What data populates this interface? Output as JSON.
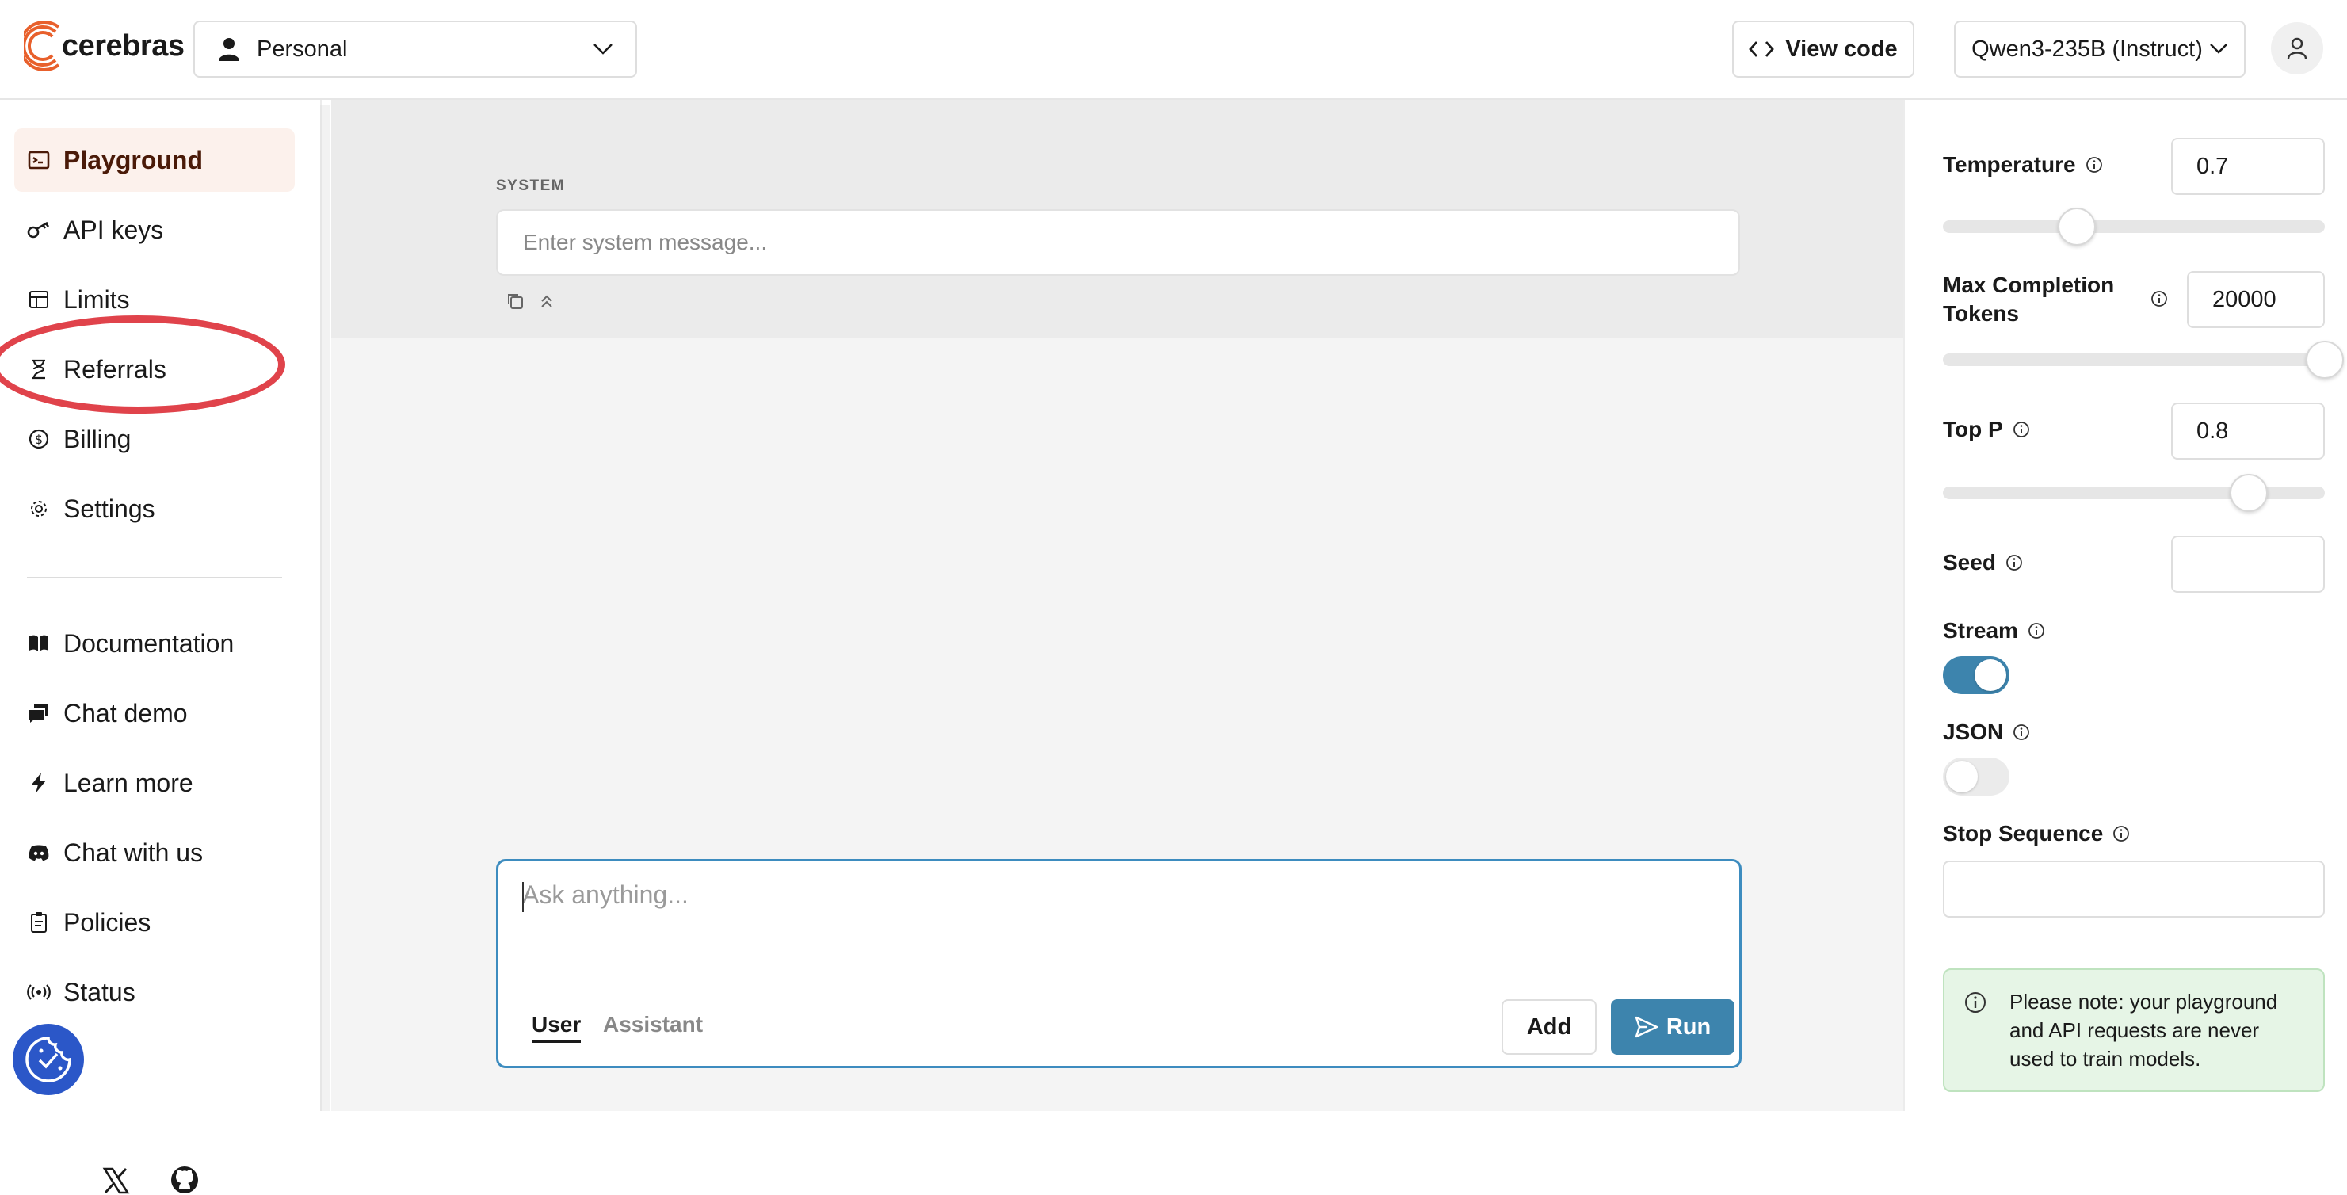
{
  "header": {
    "logo_text": "cerebras",
    "org_select": "Personal",
    "view_code_label": "View code",
    "model_select": "Qwen3-235B (Instruct)"
  },
  "sidebar": {
    "items": [
      {
        "label": "Playground",
        "icon": "playground-icon",
        "active": true
      },
      {
        "label": "API keys",
        "icon": "key-icon"
      },
      {
        "label": "Limits",
        "icon": "table-icon"
      },
      {
        "label": "Referrals",
        "icon": "hourglass-icon"
      },
      {
        "label": "Billing",
        "icon": "dollar-icon"
      },
      {
        "label": "Settings",
        "icon": "gear-icon"
      }
    ],
    "links": [
      {
        "label": "Documentation",
        "icon": "book-icon"
      },
      {
        "label": "Chat demo",
        "icon": "chat-icon"
      },
      {
        "label": "Learn more",
        "icon": "bolt-icon"
      },
      {
        "label": "Chat with us",
        "icon": "discord-icon"
      },
      {
        "label": "Policies",
        "icon": "clipboard-icon"
      },
      {
        "label": "Status",
        "icon": "broadcast-icon"
      }
    ]
  },
  "main": {
    "system_label": "SYSTEM",
    "system_placeholder": "Enter system message...",
    "chat_placeholder": "Ask anything...",
    "role_user": "User",
    "role_assistant": "Assistant",
    "add_label": "Add",
    "run_label": "Run"
  },
  "panel": {
    "temperature_label": "Temperature",
    "temperature_value": "0.7",
    "temperature_fraction": 0.35,
    "max_tokens_label_1": "Max Completion",
    "max_tokens_label_2": "Tokens",
    "max_tokens_value": "20000",
    "max_tokens_fraction": 1.0,
    "top_p_label": "Top P",
    "top_p_value": "0.8",
    "top_p_fraction": 0.8,
    "seed_label": "Seed",
    "seed_value": "",
    "stream_label": "Stream",
    "stream_on": true,
    "json_label": "JSON",
    "json_on": false,
    "stop_sequence_label": "Stop Sequence",
    "stop_sequence_value": "",
    "note": "Please note: your playground and API requests are never used to train models."
  },
  "colors": {
    "accent": "#3d84ad",
    "brand": "#e8602c",
    "highlight_ring": "#e0434b",
    "active_nav_bg": "#fcf1ec",
    "note_bg": "#e6f5e6"
  }
}
